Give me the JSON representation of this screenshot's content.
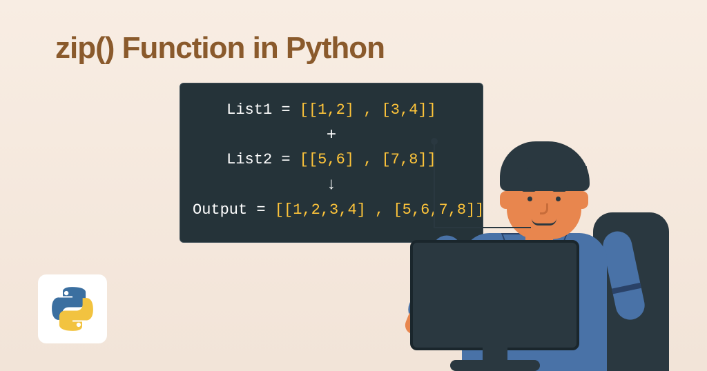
{
  "title": "zip() Function in Python",
  "code": {
    "line1_label": "List1 = ",
    "line1_value": "[[1,2] , [3,4]]",
    "plus": "+",
    "line2_label": "List2 = ",
    "line2_value": "[[5,6] , [7,8]]",
    "arrow": "↓",
    "line3_label": "Output = ",
    "line3_value": "[[1,2,3,4] , [5,6,7,8]]"
  }
}
